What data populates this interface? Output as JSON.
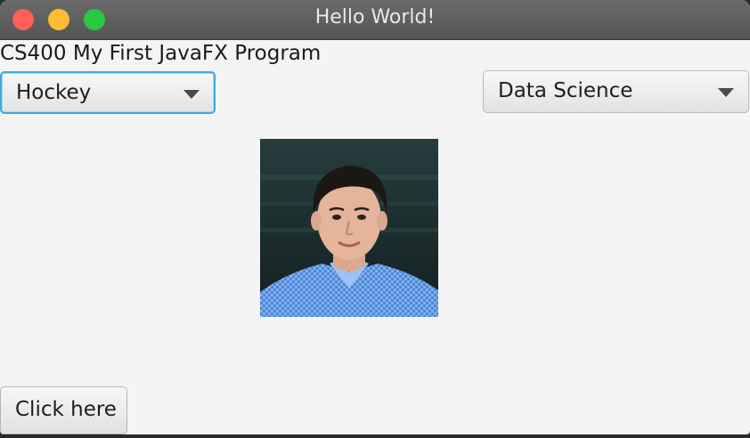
{
  "window": {
    "title": "Hello World!"
  },
  "main": {
    "heading": "CS400 My First JavaFX Program",
    "left_combo": {
      "selected": "Hockey"
    },
    "right_combo": {
      "selected": "Data Science"
    },
    "photo_description": "portrait photo",
    "button_label": "Click here"
  },
  "colors": {
    "focus_ring": "#3fa9e0",
    "close": "#fe5f57",
    "minimize": "#febc2e",
    "maximize": "#28c840"
  }
}
